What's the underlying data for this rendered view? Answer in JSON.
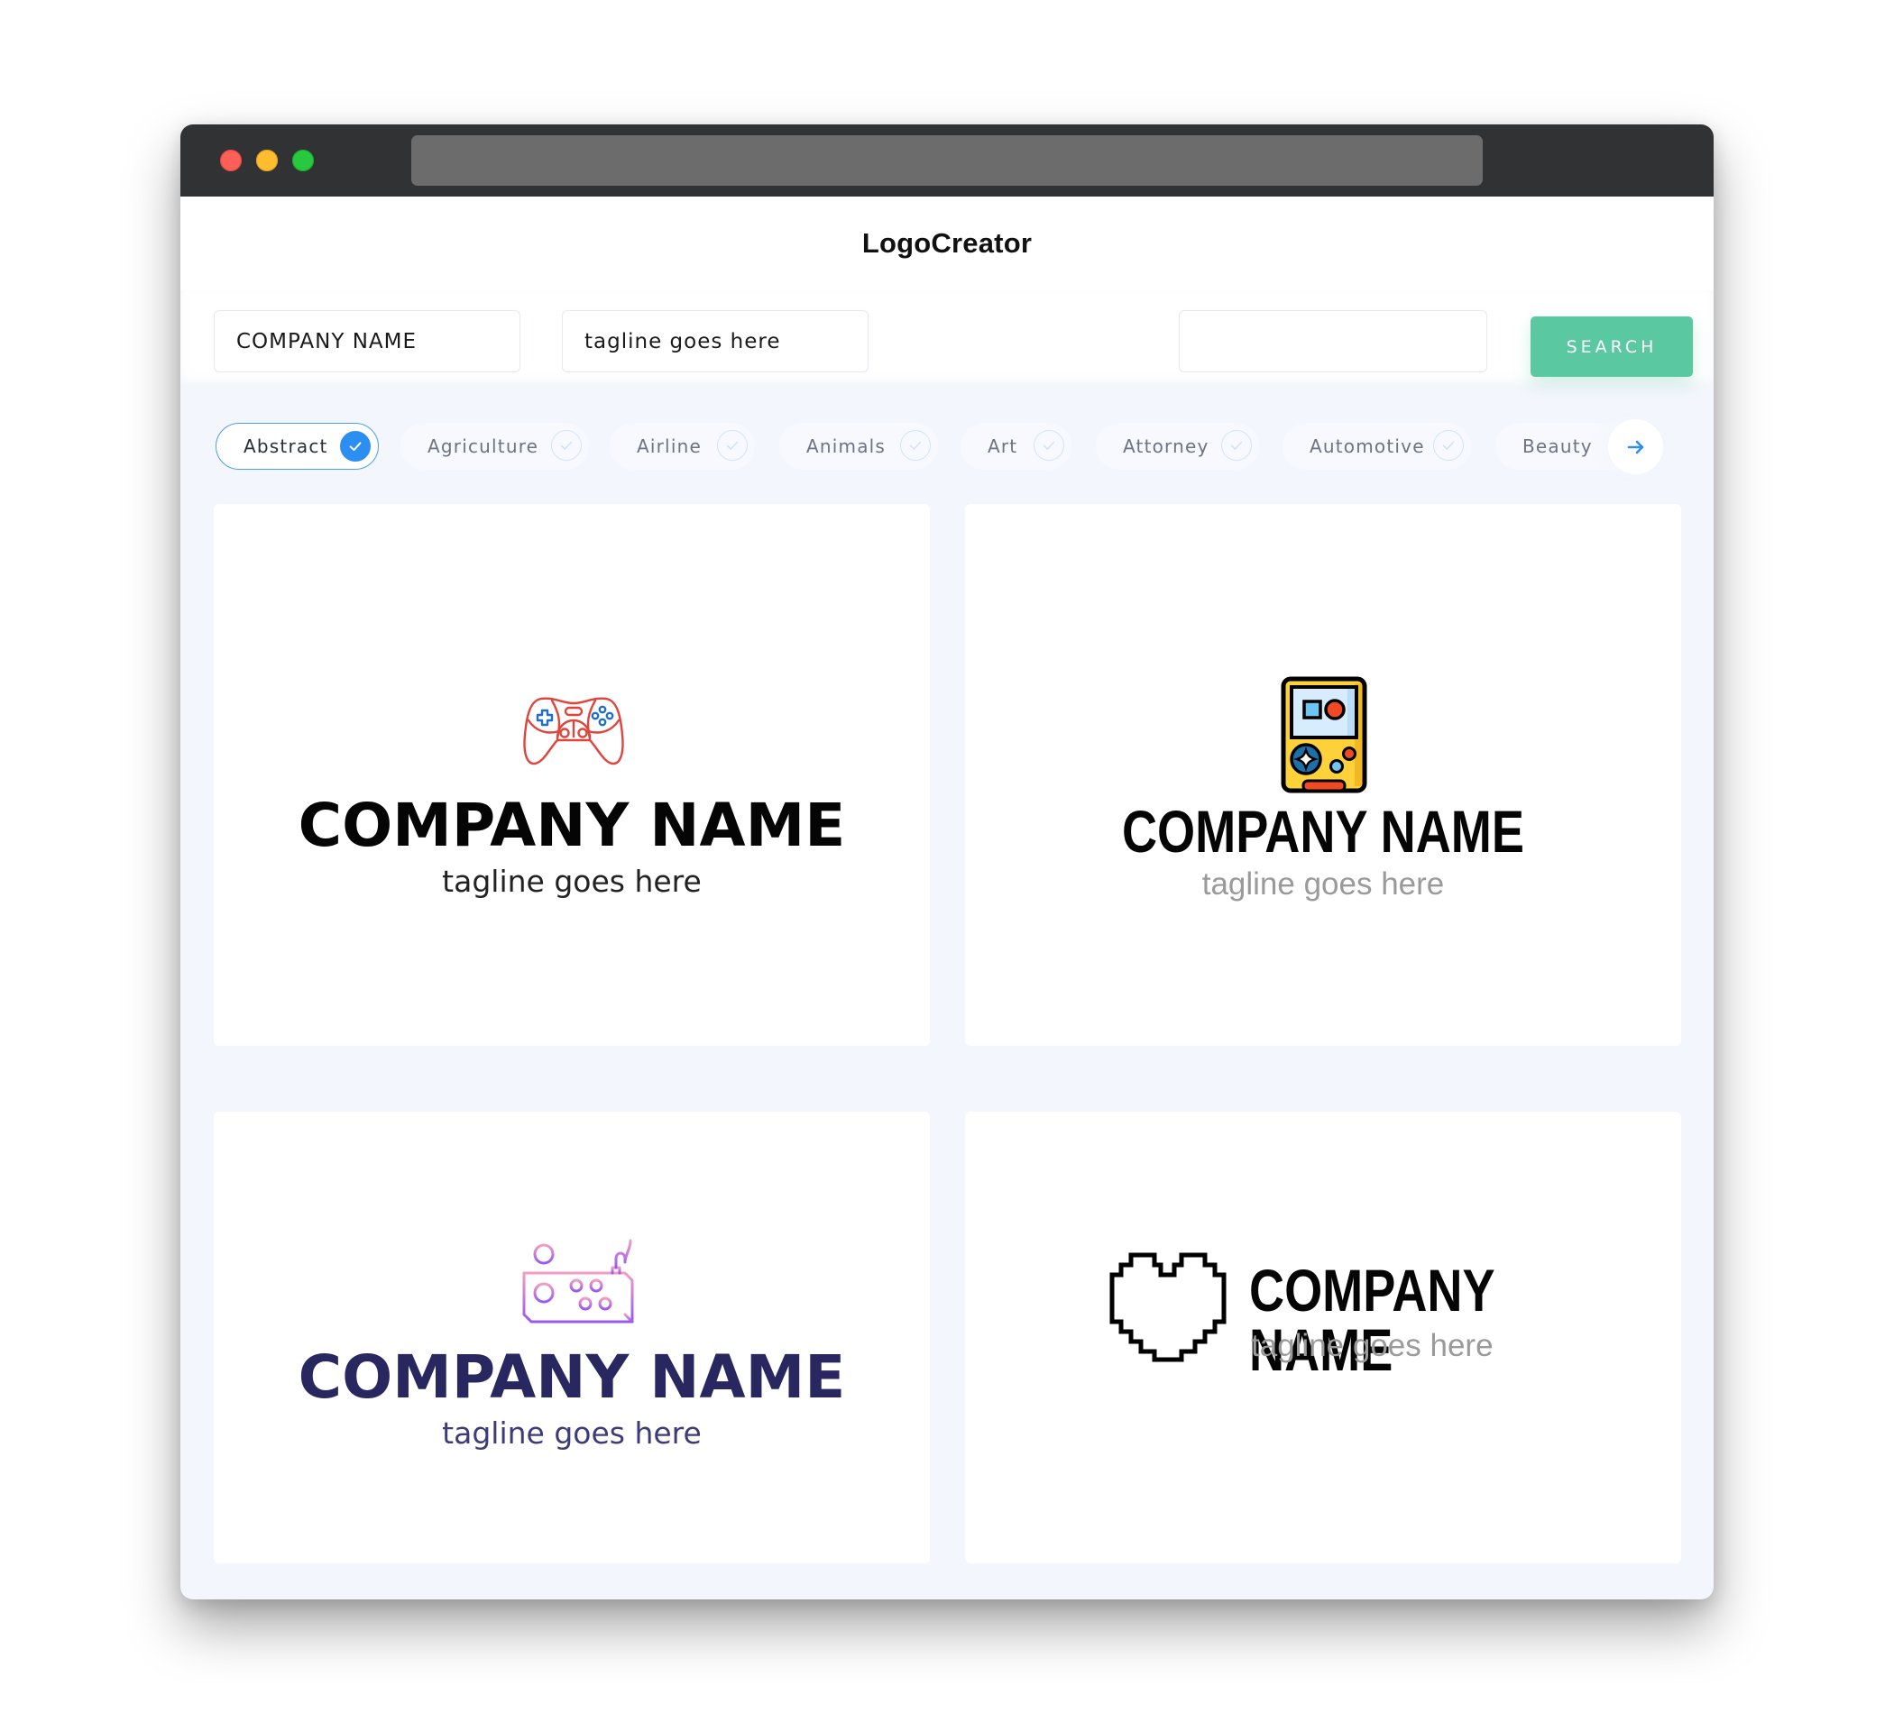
{
  "browser": {
    "window_controls": [
      "close",
      "minimize",
      "maximize"
    ],
    "url": ""
  },
  "header": {
    "title": "LogoCreator"
  },
  "form": {
    "company_name_value": "COMPANY NAME",
    "tagline_value": "tagline goes here",
    "keyword_value": "",
    "search_label": "SEARCH"
  },
  "categories": {
    "items": [
      {
        "label": "Abstract",
        "selected": true
      },
      {
        "label": "Agriculture",
        "selected": false
      },
      {
        "label": "Airline",
        "selected": false
      },
      {
        "label": "Animals",
        "selected": false
      },
      {
        "label": "Art",
        "selected": false
      },
      {
        "label": "Attorney",
        "selected": false
      },
      {
        "label": "Automotive",
        "selected": false
      },
      {
        "label": "Beauty",
        "selected": false
      }
    ],
    "next_icon": "arrow-right-icon"
  },
  "logos": [
    {
      "icon": "gamepad-icon",
      "company": "COMPANY NAME",
      "tagline": "tagline goes here",
      "name_color": "#050505",
      "tagline_color": "#222222",
      "icon_colors": [
        "#e0443a",
        "#1f6fc9"
      ]
    },
    {
      "icon": "handheld-console-icon",
      "company": "COMPANY NAME",
      "tagline": "tagline goes here",
      "name_color": "#050505",
      "tagline_color": "#9a9a9a",
      "icon_colors": [
        "#fcd13a",
        "#cfeaff",
        "#f04a24",
        "#1d6fa8",
        "#000000"
      ]
    },
    {
      "icon": "arcade-controller-icon",
      "company": "COMPANY NAME",
      "tagline": "tagline goes here",
      "name_color": "#29275f",
      "tagline_color": "#3d3b78",
      "icon_colors": [
        "#a05cf0",
        "#f29cc4"
      ]
    },
    {
      "icon": "pixel-heart-icon",
      "company": "COMPANY NAME",
      "tagline": "tagline goes here",
      "name_color": "#050505",
      "tagline_color": "#9a9a9a",
      "icon_colors": [
        "#000000"
      ]
    }
  ],
  "colors": {
    "accent": "#2d8ef2",
    "search_button": "#5ac8a0",
    "titlebar": "#313234",
    "page_background": "#f3f6fd"
  }
}
